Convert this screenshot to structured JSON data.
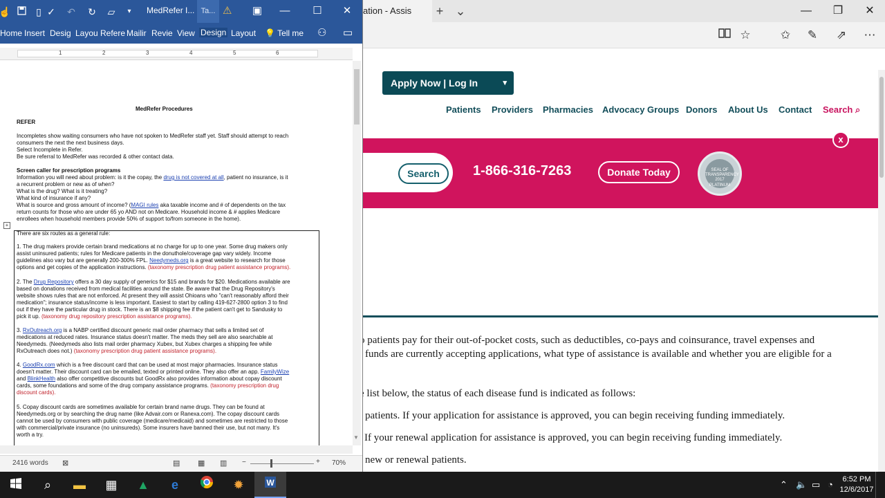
{
  "browser": {
    "tab_title": "ation - Assis",
    "tab_new": "+",
    "tab_list": "⌄",
    "minimize": "—",
    "restore": "❐",
    "close": "✕",
    "toolbar_icons": [
      "reading-view-icon",
      "favorite-star-icon",
      "favorites-hub-icon",
      "pen-notes-icon",
      "share-icon",
      "more-icon"
    ]
  },
  "site": {
    "apply_label": "Apply Now | Log In",
    "apply_caret": "▾",
    "nav": [
      "Patients",
      "Providers",
      "Pharmacies",
      "Advocacy Groups",
      "Donors",
      "About Us",
      "Contact"
    ],
    "nav_search": "Search",
    "search_button": "Search",
    "phone": "1-866-316-7263",
    "donate_button": "Donate Today",
    "seal_text": "SEAL OF TRANSPARENCY 2017 PLATINUM",
    "close_banner": "x",
    "body_lines": [
      "o patients pay for their out-of-pocket costs, such as deductibles, co-pays and coinsurance, travel expenses and",
      "funds are currently accepting applications, what type of assistance is available and whether you are eligible for a",
      "e list below, the status of each disease fund is indicated as follows:",
      "patients. If your application for assistance is approved, you can begin receiving funding immediately.",
      "If your renewal application for assistance is approved, you can begin receiving funding immediately.",
      "new or renewal patients."
    ],
    "colors": {
      "teal": "#134e5a",
      "magenta": "#d0145d"
    }
  },
  "word": {
    "doc_title": "MedRefer I...",
    "tab_short": "Ta...",
    "ribbon_tabs": [
      "Home",
      "Insert",
      "Desig",
      "Layou",
      "Refere",
      "Mailir",
      "Revie",
      "View",
      "Design",
      "Layout"
    ],
    "tell_me": "Tell me",
    "ruler_numbers": [
      "1",
      "2",
      "3",
      "4",
      "5",
      "6"
    ],
    "status_words": "2416 words",
    "zoom_percent": "70%",
    "doc": {
      "title": "MedRefer Procedures",
      "refer_heading": "REFER",
      "p1": [
        "Incompletes show waiting consumers who have not spoken to MedRefer staff yet. Staff should attempt to reach",
        "consumers the next the next business days.",
        "Select Incomplete in Refer.",
        "Be sure referral to MedRefer was recorded & other contact data."
      ],
      "screen_heading": "Screen caller for prescription programs",
      "p2a": "Information you will need about problem: is it the copay, the",
      "p2a_link": "drug is not covered at all",
      "p2a_tail": ", patient no insurance, is it",
      "p2": [
        "a recurrent problem or new as of when?",
        "What is the drug? What is it treating?",
        "What kind of insurance if any?"
      ],
      "p3a": "What is source and gross amount of income? (",
      "p3a_link": "MAGI rules",
      "p3a_tail": " aka taxable income and # of dependents on the tax",
      "p3": [
        "return counts for those who are under 65 yo AND not on Medicare. Household income & # applies Medicare",
        "enrollees when household members provide 50% of support to/from someone in the home)."
      ],
      "routes_intro": "There are six routes as a general rule:",
      "route1": [
        "1. The drug makers provide certain brand medications at no charge for up to one year. Some drug makers only",
        "assist uninsured patients; rules for Medicare patients in the donuthole/coverage gap vary widely. Income",
        "guidelines also vary but are generally 200-300% FPL.",
        "options and get copies of the application instructions."
      ],
      "route1_link": "Needymeds.org",
      "route1_tail": " is a great website to research for those",
      "route1_red": "(taxonomy prescription drug patient assistance programs).",
      "route2_prefix": "2. The",
      "route2_link": "Drug Repository",
      "route2_rest": "offers a 30 day supply of generics for $15 and brands for $20. Medications available are",
      "route2": [
        "based on donations received from medical facilities around the state. Be aware that the Drug Repository's",
        "website shows rules that are not enforced. At present they will assist Ohioans who \"can't reasonably afford their",
        "medication\"; insurance status/income is less important. Easiest to start by calling 419-627-2800 option 3 to find",
        "out if they have the particular drug in stock. There is an $8 shipping fee if the patient can't get to Sandusky to",
        "pick it up."
      ],
      "route2_red": "(taxonomy drug repository prescription assistance programs).",
      "route3_prefix": "3.",
      "route3_link": "RxOutreach.org",
      "route3_rest": "is a NABP certified discount generic mail order pharmacy that sells a limited set of",
      "route3": [
        "medications at reduced rates. Insurance status doesn't matter. The meds they sell are also searchable at",
        "Needymeds. (Needymeds also lists mail order pharmacy Xubex, but Xubex charges a shipping fee while",
        "RxOutreach does not.)"
      ],
      "route3_red": "(taxonomy prescription drug patient assistance programs).",
      "route4_prefix": "4.",
      "route4_link": "GoodRx.com",
      "route4_rest": "which is a free discount card that can be used at most major pharmacies. Insurance status",
      "route4_l2": "doesn't matter. Their discount card can be emailed, texted or printed online. They also offer an app.",
      "route4_link2": "FamilyWize",
      "route4_l3a": "and",
      "route4_link3": "BlinkHealth",
      "route4_l3b": "also offer competitive discounts but GoodRx also provides information about copay discount",
      "route4_l4": "cards, some foundations and some of the drug company assistance programs.",
      "route4_red1": "(taxonomy prescription drug",
      "route4_red2": "discount cards).",
      "route5": [
        "5.  Copay discount cards are sometimes available for certain brand name drugs. They can be found at",
        "Needymeds.org or by searching the drug name (like Advair.com or Ranexa.com). The copay discount cards",
        "cannot be used by consumers with public coverage (medicare/medicaid) and sometimes are restricted to those",
        "with commercial/private insurance (no uninsureds). Some insurers have banned their use, but not many. It's",
        "worth a try."
      ]
    }
  },
  "taskbar": {
    "apps": [
      "start-icon",
      "search-icon",
      "file-explorer-icon",
      "calculator-icon",
      "google-drive-icon",
      "edge-icon",
      "chrome-icon",
      "app-icon",
      "word-icon"
    ],
    "time": "6:52 PM",
    "date": "12/6/2017"
  }
}
